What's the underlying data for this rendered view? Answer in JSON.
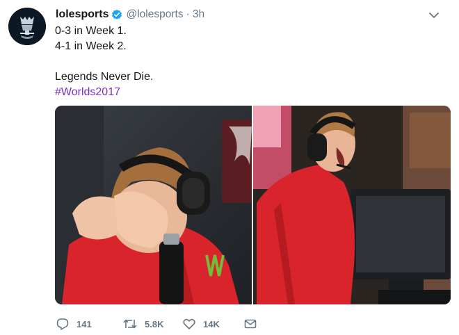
{
  "tweet": {
    "display_name": "lolesports",
    "handle": "@lolesports",
    "separator": "·",
    "time": "3h",
    "text_lines": [
      "0-3 in Week 1.",
      "4-1 in Week 2.",
      "",
      "Legends Never Die."
    ],
    "hashtag": "#Worlds2017",
    "media": [
      {
        "name": "player-facepalm-photo"
      },
      {
        "name": "player-celebrating-photo"
      }
    ]
  },
  "avatar": {
    "icon": "worlds-trophy-logo"
  },
  "actions": {
    "reply_count": "141",
    "retweet_count": "5.8K",
    "like_count": "14K"
  },
  "colors": {
    "text": "#14171a",
    "muted": "#657786",
    "hashtag": "#7c2fc5",
    "verified": "#1da1f2",
    "jersey_red": "#d8242a"
  }
}
